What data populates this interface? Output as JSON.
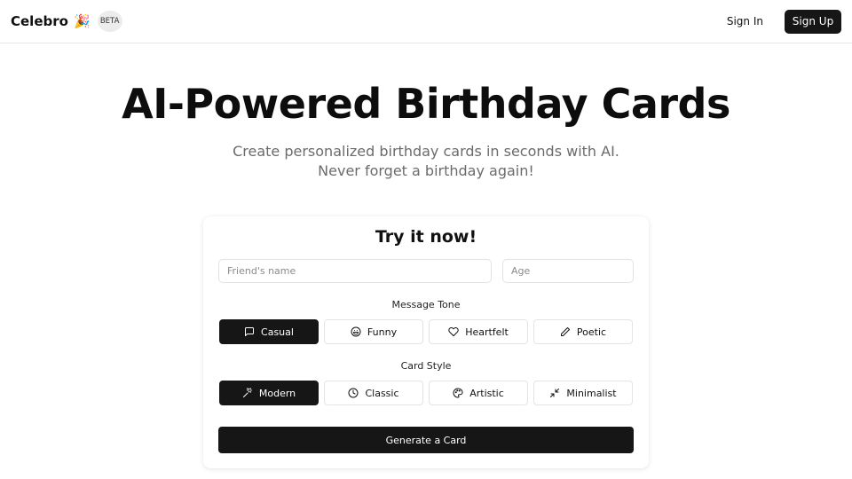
{
  "header": {
    "brand_name": "Celebro",
    "brand_emoji": "🎉",
    "beta_badge": "BETA",
    "sign_in": "Sign In",
    "sign_up": "Sign Up"
  },
  "hero": {
    "title": "AI-Powered Birthday Cards",
    "subtitle": "Create personalized birthday cards in seconds with AI. Never forget a birthday again!"
  },
  "card": {
    "title": "Try it now!",
    "name_placeholder": "Friend's name",
    "age_placeholder": "Age",
    "tone_label": "Message Tone",
    "tones": [
      {
        "label": "Casual",
        "icon": "chat-bubble-icon",
        "selected": true
      },
      {
        "label": "Funny",
        "icon": "laugh-face-icon",
        "selected": false
      },
      {
        "label": "Heartfelt",
        "icon": "heart-icon",
        "selected": false
      },
      {
        "label": "Poetic",
        "icon": "pencil-icon",
        "selected": false
      }
    ],
    "style_label": "Card Style",
    "styles": [
      {
        "label": "Modern",
        "icon": "sparkle-wand-icon",
        "selected": true
      },
      {
        "label": "Classic",
        "icon": "clock-icon",
        "selected": false
      },
      {
        "label": "Artistic",
        "icon": "palette-icon",
        "selected": false
      },
      {
        "label": "Minimalist",
        "icon": "minimize-icon",
        "selected": false
      }
    ],
    "generate_label": "Generate a Card"
  },
  "colors": {
    "primary": "#161616",
    "muted_text": "#6b6b6b",
    "border": "#e4e4e4",
    "background": "#ffffff"
  }
}
